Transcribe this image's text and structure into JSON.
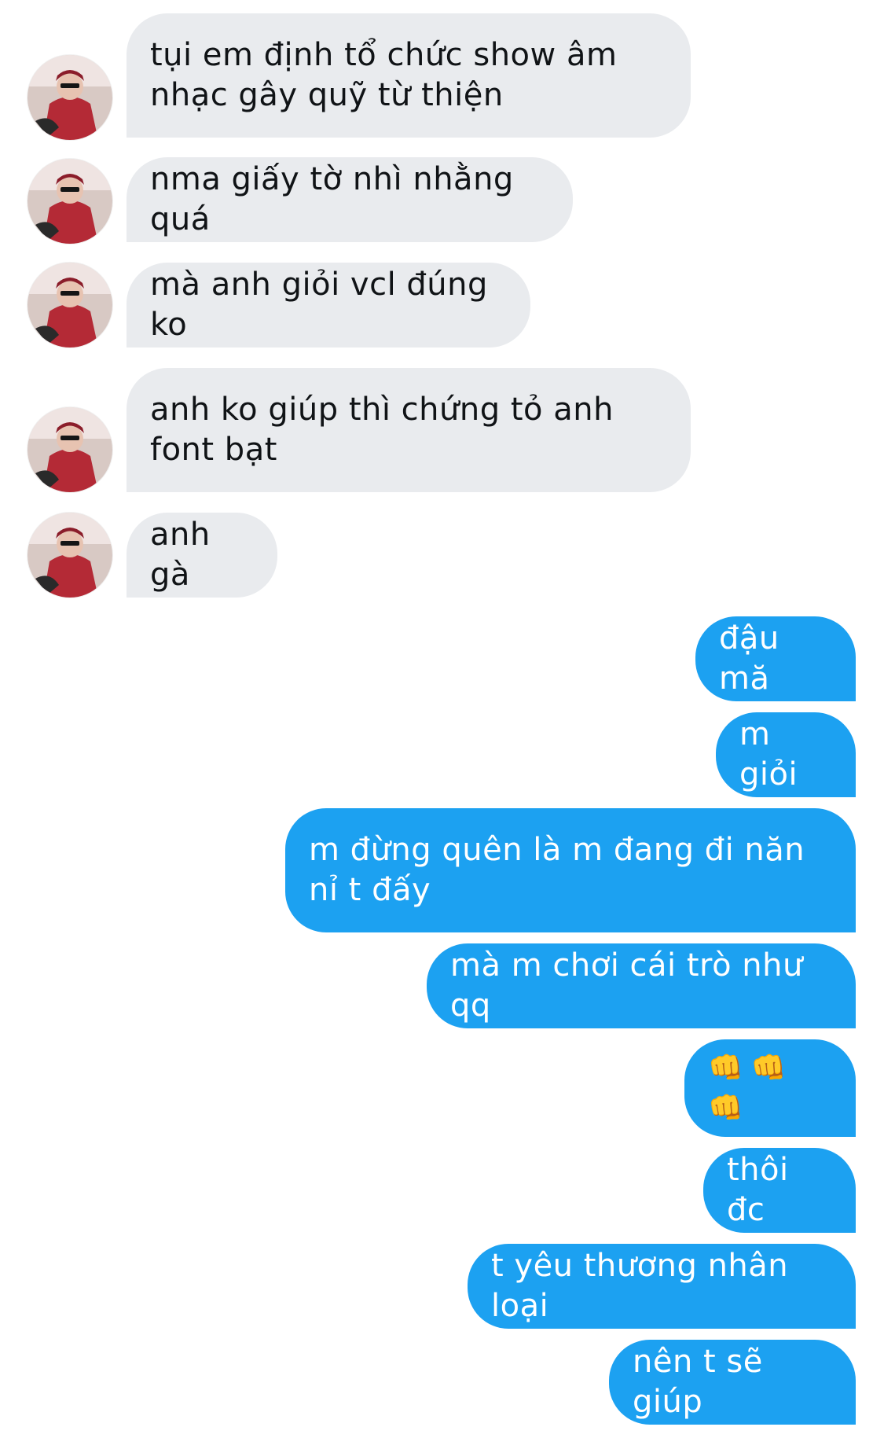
{
  "conversation": {
    "incoming": [
      {
        "text": "tụi em định tổ chức show âm nhạc gây quỹ từ thiện"
      },
      {
        "text": "nma giấy tờ nhì nhằng quá"
      },
      {
        "text": "mà anh giỏi vcl đúng ko"
      },
      {
        "text": "anh ko giúp thì chứng tỏ anh font bạt"
      },
      {
        "text": "anh gà"
      }
    ],
    "outgoing": [
      {
        "text": "đậu mă"
      },
      {
        "text": "m giỏi"
      },
      {
        "text": "m đừng quên là m đang đi năn nỉ t đấy"
      },
      {
        "text": "mà m chơi cái trò như qq"
      },
      {
        "text": "👊👊👊"
      },
      {
        "text": "thôi đc"
      },
      {
        "text": "t yêu thương nhân loại"
      },
      {
        "text": "nên t sẽ giúp"
      }
    ]
  },
  "colors": {
    "incoming_bubble": "#e9ebee",
    "outgoing_bubble": "#1ca1f1",
    "background": "#ffffff"
  },
  "icons": {
    "avatar": "user-avatar-photo"
  }
}
